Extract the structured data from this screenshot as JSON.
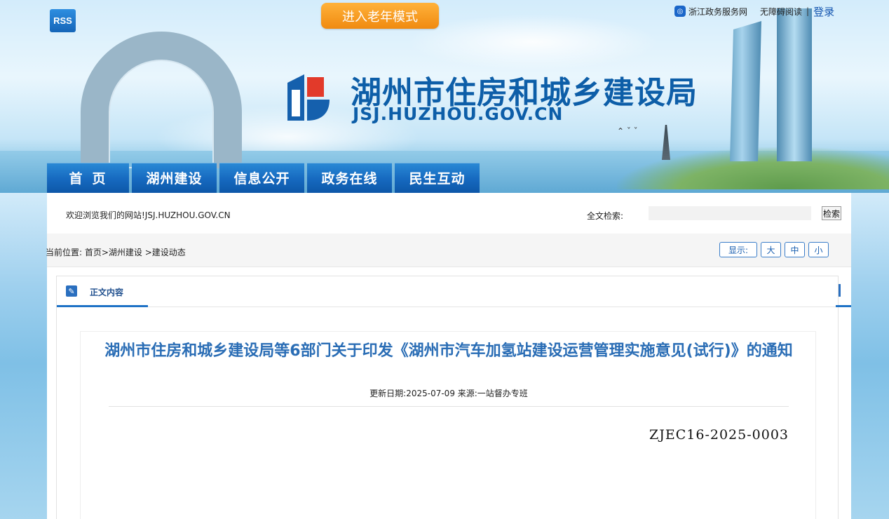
{
  "header": {
    "rss_label": "RSS",
    "elder_mode": "进入老年模式",
    "zj_service": "浙江政务服务网",
    "barrier_free": "无障碍阅读",
    "separator": "|",
    "login": "登录",
    "site_name": "湖州市住房和城乡建设局",
    "site_domain": "JSJ.HUZHOU.GOV.CN"
  },
  "nav": [
    {
      "label": "首页"
    },
    {
      "label": "湖州建设"
    },
    {
      "label": "信息公开"
    },
    {
      "label": "政务在线"
    },
    {
      "label": "民生互动"
    }
  ],
  "welcome": "欢迎浏览我们的网站!JSJ.HUZHOU.GOV.CN",
  "search": {
    "label": "全文检索:",
    "value": "",
    "button": "检索"
  },
  "breadcrumb": {
    "label": "当前位置:",
    "path": "首页>湖州建设 >建设动态"
  },
  "font_size": {
    "display_label": "显示:",
    "large": "大",
    "medium": "中",
    "small": "小"
  },
  "content": {
    "tab_title": "正文内容",
    "title": "湖州市住房和城乡建设局等6部门关于印发《湖州市汽车加氢站建设运营管理实施意见(试行)》的通知",
    "meta": "更新日期:2025-07-09 来源:一站督办专班",
    "doc_number": "ZJEC16-2025-0003"
  },
  "colors": {
    "primary_blue": "#1669bf",
    "title_blue": "#2a6db5",
    "elder_orange": "#f08a10"
  }
}
